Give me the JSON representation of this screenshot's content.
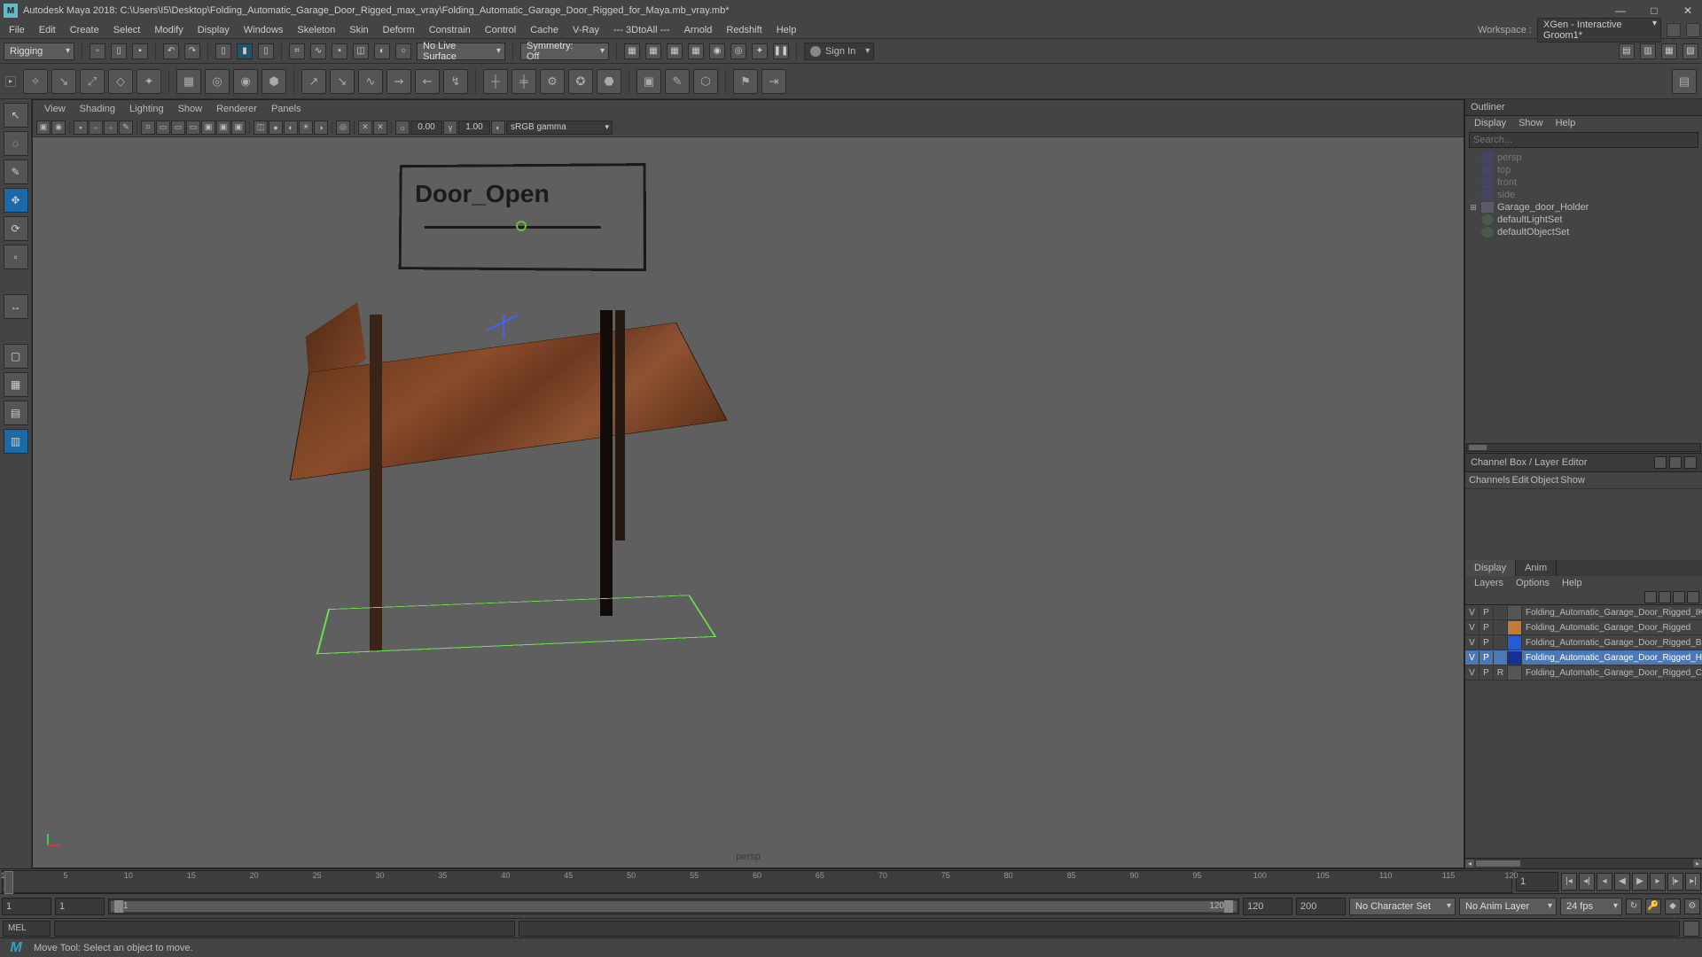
{
  "window": {
    "title": "Autodesk Maya 2018: C:\\Users\\I5\\Desktop\\Folding_Automatic_Garage_Door_Rigged_max_vray\\Folding_Automatic_Garage_Door_Rigged_for_Maya.mb_vray.mb*"
  },
  "menubar": {
    "items": [
      "File",
      "Edit",
      "Create",
      "Select",
      "Modify",
      "Display",
      "Windows",
      "Skeleton",
      "Skin",
      "Deform",
      "Constrain",
      "Control",
      "Cache",
      "V-Ray",
      "--- 3DtoAll ---",
      "Arnold",
      "Redshift",
      "Help"
    ],
    "workspace_label": "Workspace :",
    "workspace_value": "XGen - Interactive Groom1*"
  },
  "statusline": {
    "module": "Rigging",
    "live_surface": "No Live Surface",
    "symmetry": "Symmetry: Off",
    "signin": "Sign In"
  },
  "viewport": {
    "menus": [
      "View",
      "Shading",
      "Lighting",
      "Show",
      "Renderer",
      "Panels"
    ],
    "exposure": "0.00",
    "gamma": "1.00",
    "colorspace": "sRGB gamma",
    "camera_label": "persp",
    "sign_text": "Door_Open"
  },
  "outliner": {
    "title": "Outliner",
    "menus": [
      "Display",
      "Show",
      "Help"
    ],
    "search_placeholder": "Search...",
    "items": [
      {
        "label": "persp",
        "type": "cam",
        "dim": true
      },
      {
        "label": "top",
        "type": "cam",
        "dim": true
      },
      {
        "label": "front",
        "type": "cam",
        "dim": true
      },
      {
        "label": "side",
        "type": "cam",
        "dim": true
      },
      {
        "label": "Garage_door_Holder",
        "type": "grp",
        "dim": false,
        "expandable": true
      },
      {
        "label": "defaultLightSet",
        "type": "set",
        "dim": false
      },
      {
        "label": "defaultObjectSet",
        "type": "set",
        "dim": false
      }
    ]
  },
  "channelbox": {
    "title": "Channel Box / Layer Editor",
    "menus": [
      "Channels",
      "Edit",
      "Object",
      "Show"
    ]
  },
  "layers": {
    "tabs": [
      "Display",
      "Anim"
    ],
    "active_tab": "Display",
    "menus": [
      "Layers",
      "Options",
      "Help"
    ],
    "rows": [
      {
        "v": "V",
        "p": "P",
        "r": "",
        "swatch": "gray",
        "name": "Folding_Automatic_Garage_Door_Rigged_IK_Ct",
        "sel": false
      },
      {
        "v": "V",
        "p": "P",
        "r": "",
        "swatch": "orange",
        "name": "Folding_Automatic_Garage_Door_Rigged",
        "sel": false
      },
      {
        "v": "V",
        "p": "P",
        "r": "",
        "swatch": "blue",
        "name": "Folding_Automatic_Garage_Door_Rigged_Bon",
        "sel": false
      },
      {
        "v": "V",
        "p": "P",
        "r": "",
        "swatch": "dblue",
        "name": "Folding_Automatic_Garage_Door_Rigged_Helpers",
        "sel": true
      },
      {
        "v": "V",
        "p": "P",
        "r": "R",
        "swatch": "gray",
        "name": "Folding_Automatic_Garage_Door_Rigged_Controller",
        "sel": false
      }
    ]
  },
  "timeline": {
    "current_frame": "1",
    "ticks": [
      "1",
      "5",
      "10",
      "15",
      "20",
      "25",
      "30",
      "35",
      "40",
      "45",
      "50",
      "55",
      "60",
      "65",
      "70",
      "75",
      "80",
      "85",
      "90",
      "95",
      "100",
      "105",
      "110",
      "115",
      "120"
    ]
  },
  "range": {
    "start_out": "1",
    "start_in": "1",
    "end_in": "120",
    "end_out": "120",
    "end_out2": "200",
    "char_set": "No Character Set",
    "anim_layer": "No Anim Layer",
    "fps": "24 fps"
  },
  "cmd": {
    "lang": "MEL"
  },
  "help": {
    "message": "Move Tool: Select an object to move."
  }
}
